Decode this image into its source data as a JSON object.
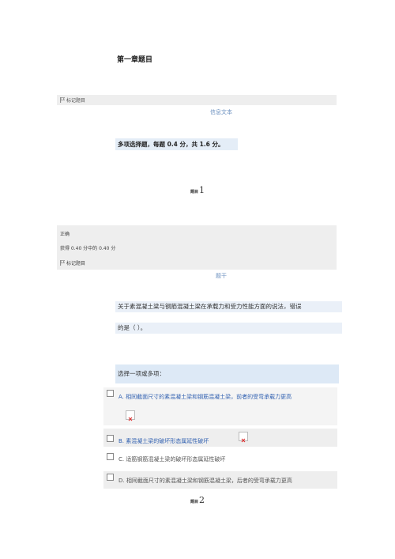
{
  "chapter_title": "第一章题目",
  "flag_label": "标记题目",
  "info_text": "信息文本",
  "instructions": "多项选择题，每题 0.4 分，共 1.6 分。",
  "q1": {
    "label": "题目",
    "number": "1",
    "status": "正确",
    "score": "获得 0.40 分中的 0.40 分",
    "flag_label": "标记题目",
    "stem_heading": "题干",
    "stem_line1": "关于素混凝土梁与钢筋混凝土梁在承载力和受力性能方面的说法，错误",
    "stem_line2": "的是（     ）。",
    "options_prompt": "选择一项或多项：",
    "options": [
      {
        "letter": "A.",
        "text": " 相同截面尺寸的素混凝土梁和钢筋混凝土梁，前者的受弯承载力更高"
      },
      {
        "letter": "B.",
        "text": " 素混凝土梁的破坏形态属延性破坏"
      },
      {
        "letter": "C.",
        "text": " 适筋钢筋混凝土梁的破坏形态属延性破坏"
      },
      {
        "letter": "D.",
        "text": " 相同截面尺寸的素混凝土梁和钢筋混凝土梁，后者的受弯承载力更高"
      }
    ]
  },
  "q2": {
    "label": "题目",
    "number": "2"
  },
  "colors": {
    "accent_blue": "#2f5fb0",
    "panel_gray": "#eeeeee",
    "highlight_blue": "#dde9f6"
  }
}
